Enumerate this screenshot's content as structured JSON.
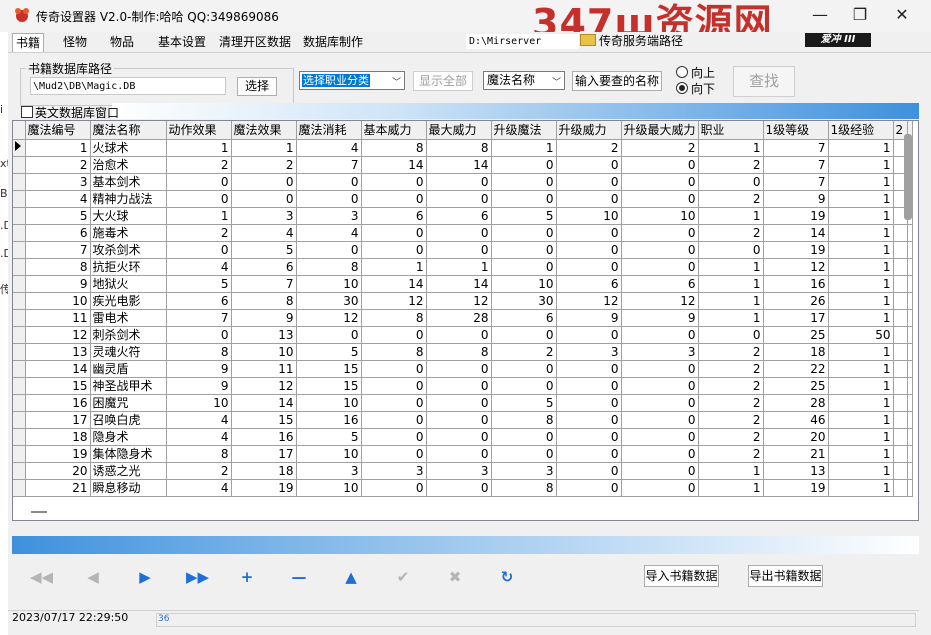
{
  "window": {
    "title": "传奇设置器 V2.0-制作:哈哈 QQ:349869086",
    "watermark": "347ш资源网",
    "min_glyph": "—",
    "max_glyph": "❐",
    "close_glyph": "✕"
  },
  "left_strip": [
    "i",
    "xt",
    "B",
    ".D",
    ".D",
    "传"
  ],
  "tabs": [
    "书籍",
    "怪物",
    "物品",
    "基本设置",
    "清理开区数据",
    "数据库制作"
  ],
  "mirserver_path": "D:\\Mirserver",
  "server_path_button": "传奇服务端路径",
  "logo": "爱冲 III",
  "db_group": {
    "title": "书籍数据库路径",
    "path": "\\Mud2\\DB\\Magic.DB",
    "choose_button": "选择"
  },
  "filters": {
    "category_value": "选择职业分类",
    "show_all_button": "显示全部",
    "field_value": "魔法名称",
    "search_name_button": "输入要查的名称",
    "radio_up": "向上",
    "radio_down": "向下",
    "radio_selected": "down",
    "find_button": "查找"
  },
  "english_window_label": "英文数据库窗口",
  "grid": {
    "columns": [
      "魔法编号",
      "魔法名称",
      "动作效果",
      "魔法效果",
      "魔法消耗",
      "基本威力",
      "最大威力",
      "升级魔法",
      "升级威力",
      "升级最大威力",
      "职业",
      "1级等级",
      "1级经验",
      "2"
    ],
    "rows": [
      [
        "1",
        "火球术",
        "1",
        "1",
        "4",
        "8",
        "8",
        "1",
        "2",
        "2",
        "1",
        "7",
        "1"
      ],
      [
        "2",
        "治愈术",
        "2",
        "2",
        "7",
        "14",
        "14",
        "0",
        "0",
        "0",
        "2",
        "7",
        "1"
      ],
      [
        "3",
        "基本剑术",
        "0",
        "0",
        "0",
        "0",
        "0",
        "0",
        "0",
        "0",
        "0",
        "7",
        "1"
      ],
      [
        "4",
        "精神力战法",
        "0",
        "0",
        "0",
        "0",
        "0",
        "0",
        "0",
        "0",
        "2",
        "9",
        "1"
      ],
      [
        "5",
        "大火球",
        "1",
        "3",
        "3",
        "6",
        "6",
        "5",
        "10",
        "10",
        "1",
        "19",
        "1"
      ],
      [
        "6",
        "施毒术",
        "2",
        "4",
        "4",
        "0",
        "0",
        "0",
        "0",
        "0",
        "2",
        "14",
        "1"
      ],
      [
        "7",
        "攻杀剑术",
        "0",
        "5",
        "0",
        "0",
        "0",
        "0",
        "0",
        "0",
        "0",
        "19",
        "1"
      ],
      [
        "8",
        "抗拒火环",
        "4",
        "6",
        "8",
        "1",
        "1",
        "0",
        "0",
        "0",
        "1",
        "12",
        "1"
      ],
      [
        "9",
        "地狱火",
        "5",
        "7",
        "10",
        "14",
        "14",
        "10",
        "6",
        "6",
        "1",
        "16",
        "1"
      ],
      [
        "10",
        "疾光电影",
        "6",
        "8",
        "30",
        "12",
        "12",
        "30",
        "12",
        "12",
        "1",
        "26",
        "1"
      ],
      [
        "11",
        "雷电术",
        "7",
        "9",
        "12",
        "8",
        "28",
        "6",
        "9",
        "9",
        "1",
        "17",
        "1"
      ],
      [
        "12",
        "刺杀剑术",
        "0",
        "13",
        "0",
        "0",
        "0",
        "0",
        "0",
        "0",
        "0",
        "25",
        "50"
      ],
      [
        "13",
        "灵魂火符",
        "8",
        "10",
        "5",
        "8",
        "8",
        "2",
        "3",
        "3",
        "2",
        "18",
        "1"
      ],
      [
        "14",
        "幽灵盾",
        "9",
        "11",
        "15",
        "0",
        "0",
        "0",
        "0",
        "0",
        "2",
        "22",
        "1"
      ],
      [
        "15",
        "神圣战甲术",
        "9",
        "12",
        "15",
        "0",
        "0",
        "0",
        "0",
        "0",
        "2",
        "25",
        "1"
      ],
      [
        "16",
        "困魔咒",
        "10",
        "14",
        "10",
        "0",
        "0",
        "5",
        "0",
        "0",
        "2",
        "28",
        "1"
      ],
      [
        "17",
        "召唤白虎",
        "4",
        "15",
        "16",
        "0",
        "0",
        "8",
        "0",
        "0",
        "2",
        "46",
        "1"
      ],
      [
        "18",
        "隐身术",
        "4",
        "16",
        "5",
        "0",
        "0",
        "0",
        "0",
        "0",
        "2",
        "20",
        "1"
      ],
      [
        "19",
        "集体隐身术",
        "8",
        "17",
        "10",
        "0",
        "0",
        "0",
        "0",
        "0",
        "2",
        "21",
        "1"
      ],
      [
        "20",
        "诱惑之光",
        "2",
        "18",
        "3",
        "3",
        "3",
        "3",
        "0",
        "0",
        "1",
        "13",
        "1"
      ],
      [
        "21",
        "瞬息移动",
        "4",
        "19",
        "10",
        "0",
        "0",
        "8",
        "0",
        "0",
        "1",
        "19",
        "1"
      ]
    ]
  },
  "navigator": {
    "first_icon": "first-record-icon",
    "prior_icon": "prior-record-icon",
    "next_icon": "next-record-icon",
    "last_icon": "last-record-icon",
    "insert_icon": "insert-icon",
    "delete_icon": "delete-icon",
    "edit_icon": "edit-icon",
    "post_icon": "post-icon",
    "cancel_icon": "cancel-icon",
    "refresh_icon": "refresh-icon",
    "glyphs": [
      "◀◀",
      "◀",
      "▶",
      "▶▶",
      "+",
      "—",
      "▲",
      "✔",
      "✖",
      "↻"
    ]
  },
  "import_button": "导入书籍数据",
  "export_button": "导出书籍数据",
  "status": {
    "datetime": "2023/07/17 22:29:50",
    "number": "36"
  },
  "colors": {
    "accent_blue": "#3f90dd",
    "nav_blue": "#1f6fd6",
    "watermark_red": "#c4302b"
  }
}
